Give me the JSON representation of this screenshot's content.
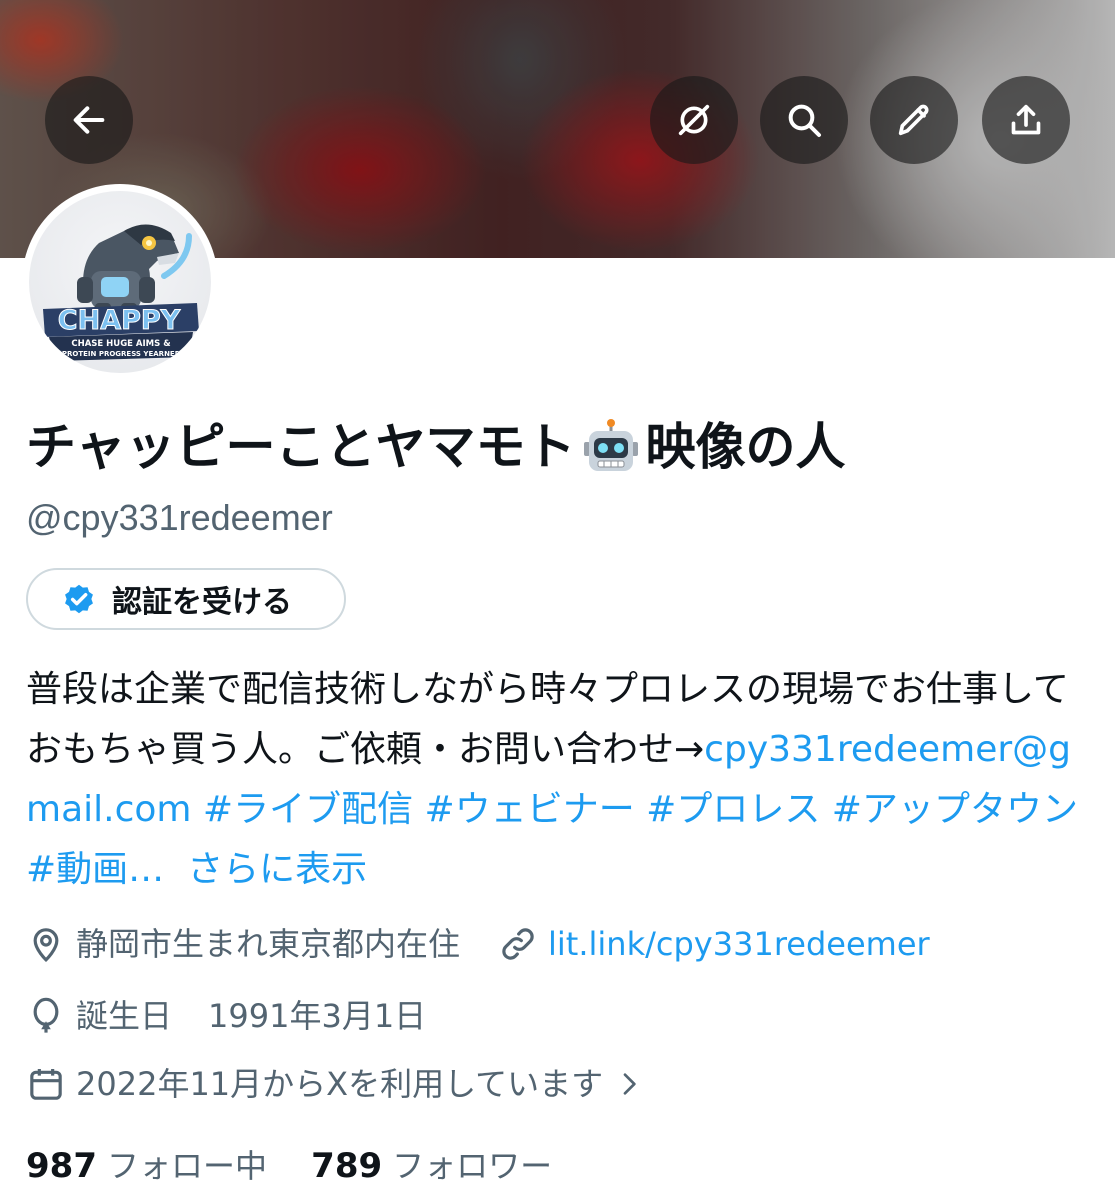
{
  "header": {
    "back": "arrow-left-icon",
    "actions": [
      "no-repost-icon",
      "search-icon",
      "edit-icon",
      "share-icon"
    ]
  },
  "profile": {
    "display_name_prefix": "チャッピーことヤマモト",
    "emoji": "robot-face-icon",
    "display_name_suffix": "映像の人",
    "avatar_logo_title": "CHAPPY",
    "avatar_logo_sub1": "CHASE HUGE AIMS &",
    "avatar_logo_sub2": "PROTEIN PROGRESS YEARNER",
    "handle": "@cpy331redeemer",
    "verify_button": "認証を受ける"
  },
  "bio": {
    "text": "普段は企業で配信技術しながら時々プロレスの現場でお仕事しておもちゃ買う人。ご依頼・お問い合わせ→",
    "email": "cpy331redeemer@gmail.com",
    "tags": [
      "#ライブ配信",
      "#ウェビナー",
      "#プロレス",
      "#アップタウン",
      "#動画…"
    ],
    "more": "さらに表示"
  },
  "meta": {
    "location": "静岡市生まれ東京都内在住",
    "link": "lit.link/cpy331redeemer",
    "birthday_label": "誕生日",
    "birthday": "1991年3月1日",
    "joined": "2022年11月からXを利用しています"
  },
  "stats": {
    "following_count": "987",
    "following_label": "フォロー中",
    "followers_count": "789",
    "followers_label": "フォロワー"
  },
  "colors": {
    "accent": "#1d9bf0",
    "secondary_text": "#536471",
    "primary_text": "#0f1419",
    "border": "#cfd9de"
  }
}
